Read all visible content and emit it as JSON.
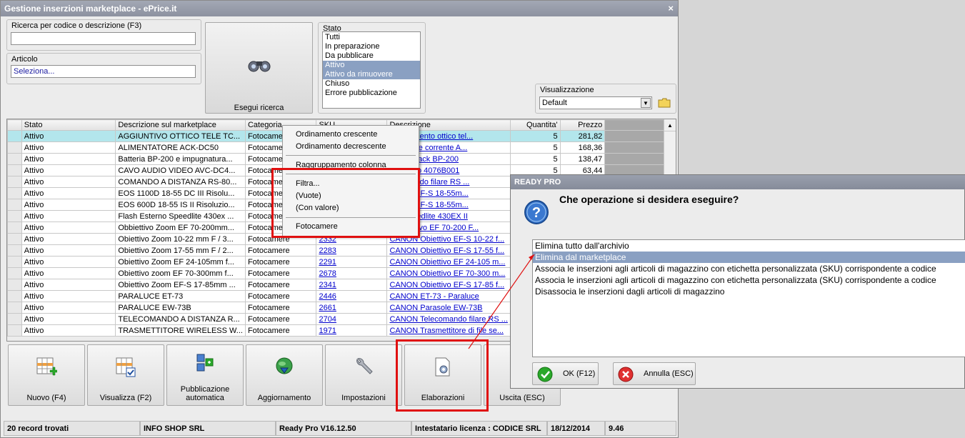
{
  "window": {
    "title": "Gestione inserzioni marketplace - ePrice.it",
    "close": "×"
  },
  "search": {
    "label": "Ricerca per codice o descrizione (F3)",
    "value": ""
  },
  "articolo": {
    "label": "Articolo",
    "value": "Seleziona..."
  },
  "esegui": {
    "label": "Esegui ricerca"
  },
  "stato": {
    "label": "Stato",
    "items": [
      "Tutti",
      "In preparazione",
      "Da pubblicare",
      "Attivo",
      "Attivo da rimuovere",
      "Chiuso",
      "Errore pubblicazione"
    ],
    "selected": [
      "Attivo",
      "Attivo da rimuovere"
    ]
  },
  "visualizzazione": {
    "label": "Visualizzazione",
    "value": "Default"
  },
  "grid": {
    "headers": [
      "Stato",
      "Descrizione sul marketplace",
      "Categoria",
      "SKU",
      "Descrizione",
      "Quantita'",
      "Prezzo"
    ],
    "rows": [
      [
        "Attivo",
        "AGGIUNTIVO OTTICO TELE TC...",
        "Fotocamere",
        "",
        "...mplemento ottico tel...",
        "5",
        "281,82"
      ],
      [
        "Attivo",
        "ALIMENTATORE ACK-DC50",
        "Fotocamere",
        "",
        "...attatore corrente A...",
        "5",
        "168,36"
      ],
      [
        "Attivo",
        "Batteria BP-200 e impugnatura...",
        "Fotocamere",
        "",
        "...ttery pack BP-200",
        "5",
        "138,47"
      ],
      [
        "Attivo",
        "CAVO AUDIO VIDEO AVC-DC4...",
        "Fotocamere",
        "",
        "...o video 4076B001",
        "5",
        "63,44"
      ],
      [
        "Attivo",
        "COMANDO A DISTANZA RS-80...",
        "Fotocamere",
        "",
        "...comando filare RS ...",
        "",
        ""
      ],
      [
        "Attivo",
        "EOS 1100D 18-55 DC III Risolu...",
        "Fotocamere",
        "",
        "...0D + EF-S 18-55m...",
        "",
        ""
      ],
      [
        "Attivo",
        "EOS 600D 18-55 IS II Risoluzio...",
        "Fotocamere",
        "",
        "...0D + EF-S 18-55m...",
        "",
        ""
      ],
      [
        "Attivo",
        "Flash Esterno Speedlite 430ex ...",
        "Fotocamere",
        "",
        "...h Speedlite 430EX II",
        "",
        ""
      ],
      [
        "Attivo",
        "Obbiettivo Zoom EF 70-200mm...",
        "Fotocamere",
        "",
        "...Obiettivo EF 70-200 F...",
        "",
        ""
      ],
      [
        "Attivo",
        "Obiettivo Zoom 10-22 mm F / 3...",
        "Fotocamere",
        "2332",
        "CANON Obiettivo EF-S 10-22 f...",
        "",
        ""
      ],
      [
        "Attivo",
        "Obiettivo Zoom 17-55 mm F / 2...",
        "Fotocamere",
        "2283",
        "CANON Obiettivo EF-S 17-55 f...",
        "",
        ""
      ],
      [
        "Attivo",
        "Obiettivo Zoom EF 24-105mm f...",
        "Fotocamere",
        "2291",
        "CANON Obiettivo EF 24-105 m...",
        "",
        ""
      ],
      [
        "Attivo",
        "Obiettivo zoom EF 70-300mm f...",
        "Fotocamere",
        "2678",
        "CANON Obiettivo EF 70-300 m...",
        "",
        ""
      ],
      [
        "Attivo",
        "Obiettivo Zoom EF-S 17-85mm ...",
        "Fotocamere",
        "2341",
        "CANON Obiettivo EF-S 17-85 f...",
        "",
        ""
      ],
      [
        "Attivo",
        "PARALUCE ET-73",
        "Fotocamere",
        "2446",
        "CANON ET-73 - Paraluce",
        "",
        ""
      ],
      [
        "Attivo",
        "PARALUCE EW-73B",
        "Fotocamere",
        "2661",
        "CANON Parasole EW-73B",
        "",
        ""
      ],
      [
        "Attivo",
        "TELECOMANDO A DISTANZA R...",
        "Fotocamere",
        "2704",
        "CANON Telecomando filare RS ...",
        "",
        ""
      ],
      [
        "Attivo",
        "TRASMETTITORE WIRELESS W...",
        "Fotocamere",
        "1971",
        "CANON Trasmettitore di file se...",
        "",
        ""
      ]
    ]
  },
  "context_menu": {
    "items": [
      "Ordinamento crescente",
      "Ordinamento decrescente",
      "Raggruppamento colonna",
      "Filtra...",
      "(Vuote)",
      "(Con valore)",
      "Fotocamere"
    ]
  },
  "toolbar": {
    "nuovo": "Nuovo (F4)",
    "visualizza": "Visualizza (F2)",
    "pubblicazione_1": "Pubblicazione",
    "pubblicazione_2": "automatica",
    "aggiornamento": "Aggiornamento",
    "impostazioni": "Impostazioni",
    "elaborazioni": "Elaborazioni",
    "uscita": "Uscita (ESC)"
  },
  "status": {
    "records": "20 record trovati",
    "company": "INFO SHOP SRL",
    "version": "Ready Pro V16.12.50",
    "license": "Intestatario licenza : CODICE SRL",
    "date": "18/12/2014",
    "time": "9.46"
  },
  "dialog": {
    "title": "READY PRO",
    "question": "Che operazione si desidera eseguire?",
    "options": [
      "Elimina tutto dall'archivio",
      "Elimina dal marketplace",
      "Associa le inserzioni agli articoli di magazzino con etichetta personalizzata (SKU) corrispondente a codice",
      "Associa le inserzioni agli articoli di magazzino con etichetta personalizzata (SKU) corrispondente a codice",
      "Disassocia le inserzioni dagli articoli di magazzino"
    ],
    "selected_index": 1,
    "ok": "OK (F12)",
    "cancel": "Annulla (ESC)"
  },
  "colors": {
    "selection": "#8aa0c2",
    "row_highlight": "#b3e6ec",
    "highlight_box": "#e01010",
    "link": "#0000cc"
  }
}
